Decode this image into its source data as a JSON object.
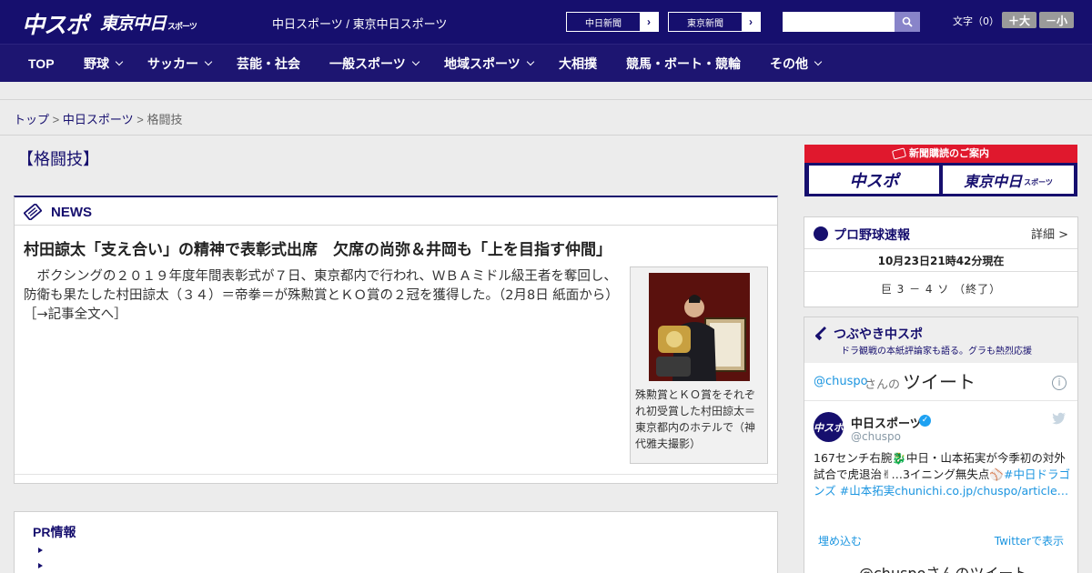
{
  "header": {
    "logo_chuspo": "中スポ",
    "logo_tokyo": "東京中日",
    "logo_tokyo_small": "スポーツ",
    "site_names": "中日スポーツ / 東京中日スポーツ",
    "link_chunichi": "中日新聞",
    "link_tokyo": "東京新聞",
    "font_label": "文字（0）",
    "font_larger": "＋大",
    "font_smaller": "－小"
  },
  "nav": {
    "items": [
      {
        "label": "TOP"
      },
      {
        "label": "野球"
      },
      {
        "label": "サッカー"
      },
      {
        "label": "芸能・社会"
      },
      {
        "label": "一般スポーツ"
      },
      {
        "label": "地域スポーツ"
      },
      {
        "label": "大相撲"
      },
      {
        "label": "競馬・ボート・競輪"
      },
      {
        "label": "その他"
      }
    ]
  },
  "breadcrumb": {
    "home": "トップ",
    "sep": ">",
    "parent": "中日スポーツ",
    "current": "格闘技"
  },
  "section_title": "【格闘技】",
  "news": {
    "label": "NEWS",
    "headline": "村田諒太「支え合い」の精神で表彰式出席　欠席の尚弥＆井岡も「上を目指す仲間」",
    "body": "　ボクシングの２０１９年度年間表彰式が７日、東京都内で行われ、ＷＢＡミドル級王者を奪回し、防衛も果たした村田諒太（３４）＝帝拳＝が殊勲賞とＫＯ賞の２冠を獲得した。（2月8日 紙面から）",
    "more": "［→記事全文へ］",
    "caption": "殊勲賞とＫＯ賞をそれぞれ初受賞した村田諒太＝東京都内のホテルで（神代雅夫撮影）"
  },
  "pr": {
    "title": "PR情報"
  },
  "subscription": {
    "title": "新聞購読のご案内",
    "logo_left": "中スポ",
    "logo_right": "東京中日",
    "logo_right_small": "スポーツ"
  },
  "baseball": {
    "title": "プロ野球速報",
    "detail": "詳細 >",
    "time": "10月23日21時42分現在",
    "score": "巨 3 － 4 ソ （終了）"
  },
  "twitter": {
    "title": "つぶやき中スポ",
    "subtitle": "ドラ観戦の本紙評論家も語る。グラも熱烈応援",
    "handle": "@chuspo",
    "handle_suffix": "さんの",
    "tweet_word": "ツイート",
    "info": "i",
    "name": "中日スポーツ",
    "screen": "@chuspo",
    "avatar": "中スポ",
    "verified": "✓",
    "text_plain": "167センチ右腕🐉中日・山本拓実が今季初の対外試合で虎退治✌…3イニング無失点⚾",
    "text_link": "#中日ドラゴンズ #山本拓実chunichi.co.jp/chuspo/article…",
    "embed": "埋め込む",
    "view": "Twitterで表示",
    "footer_title": "@chuspoさんのツイート"
  }
}
